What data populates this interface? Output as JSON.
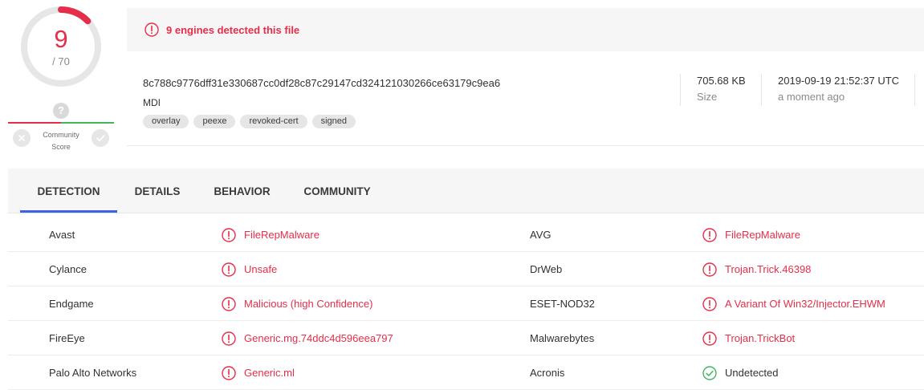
{
  "score": {
    "detected": "9",
    "total": "/ 70",
    "ring_fraction": 0.1286
  },
  "community": {
    "badge": "?",
    "label_line1": "Community",
    "label_line2": "Score"
  },
  "alert": {
    "text": "9 engines detected this file"
  },
  "file": {
    "hash": "8c788c9776dff31e330687cc0df28c87c29147cd324121030266ce63179c9ea6",
    "type": "MDI",
    "tags": [
      "overlay",
      "peexe",
      "revoked-cert",
      "signed"
    ],
    "size_value": "705.68 KB",
    "size_label": "Size",
    "date_value": "2019-09-19 21:52:37 UTC",
    "date_label": "a moment ago"
  },
  "tabs": [
    "DETECTION",
    "DETAILS",
    "BEHAVIOR",
    "COMMUNITY"
  ],
  "active_tab": "DETECTION",
  "detections": [
    {
      "left": {
        "engine": "Avast",
        "result": "FileRepMalware",
        "status": "malicious"
      },
      "right": {
        "engine": "AVG",
        "result": "FileRepMalware",
        "status": "malicious"
      }
    },
    {
      "left": {
        "engine": "Cylance",
        "result": "Unsafe",
        "status": "malicious"
      },
      "right": {
        "engine": "DrWeb",
        "result": "Trojan.Trick.46398",
        "status": "malicious"
      }
    },
    {
      "left": {
        "engine": "Endgame",
        "result": "Malicious (high Confidence)",
        "status": "malicious"
      },
      "right": {
        "engine": "ESET-NOD32",
        "result": "A Variant Of Win32/Injector.EHWM",
        "status": "malicious"
      }
    },
    {
      "left": {
        "engine": "FireEye",
        "result": "Generic.mg.74ddc4d596eea797",
        "status": "malicious"
      },
      "right": {
        "engine": "Malwarebytes",
        "result": "Trojan.TrickBot",
        "status": "malicious"
      }
    },
    {
      "left": {
        "engine": "Palo Alto Networks",
        "result": "Generic.ml",
        "status": "malicious"
      },
      "right": {
        "engine": "Acronis",
        "result": "Undetected",
        "status": "undetected"
      }
    }
  ],
  "icons": {
    "malicious": "alert-circle-icon",
    "undetected": "check-circle-icon",
    "vote_down": "close-icon",
    "vote_up": "check-icon"
  },
  "colors": {
    "danger": "#e52e4a",
    "safe": "#43b55d",
    "accent": "#3b61e6"
  }
}
